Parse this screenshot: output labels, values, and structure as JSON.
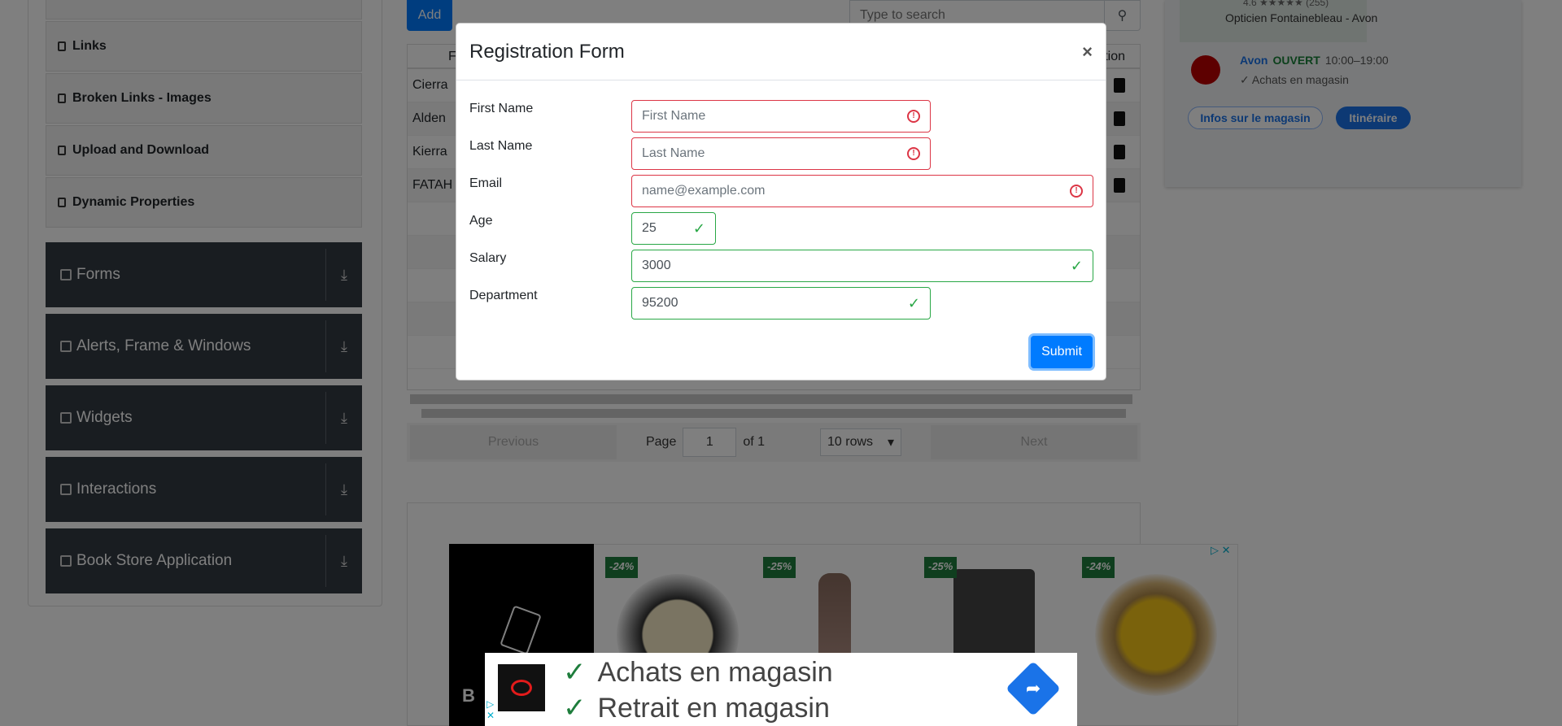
{
  "sidebar": {
    "subitems": [
      "Links",
      "Broken Links - Images",
      "Upload and Download",
      "Dynamic Properties"
    ],
    "groups": [
      "Forms",
      "Alerts, Frame & Windows",
      "Widgets",
      "Interactions",
      "Book Store Application"
    ]
  },
  "toolbar": {
    "add_label": "Add",
    "search_placeholder": "Type to search"
  },
  "table": {
    "header_first": "Fi",
    "header_action": "tion",
    "rows": [
      "Cierra",
      "Alden",
      "Kierra",
      "FATAH"
    ]
  },
  "pagination": {
    "previous": "Previous",
    "next": "Next",
    "page_label": "Page",
    "page_value": "1",
    "of_label": "of 1",
    "rows_select": "10 rows"
  },
  "map_card": {
    "rating": "4.6",
    "reviews": "(255)",
    "title": "Opticien Fontainebleau - Avon",
    "town": "Avon",
    "status": "OUVERT",
    "hours": "10:00–19:00",
    "shop": "Achats en magasin",
    "btn_info": "Infos sur le magasin",
    "btn_route": "Itinéraire"
  },
  "ad_strip": {
    "brand_letter": "B",
    "discounts": [
      "-24%",
      "-25%",
      "-25%",
      "-24%"
    ]
  },
  "modal": {
    "title": "Registration Form",
    "close": "×",
    "fields": {
      "first_name": {
        "label": "First Name",
        "placeholder": "First Name",
        "value": ""
      },
      "last_name": {
        "label": "Last Name",
        "placeholder": "Last Name",
        "value": ""
      },
      "email": {
        "label": "Email",
        "placeholder": "name@example.com",
        "value": ""
      },
      "age": {
        "label": "Age",
        "value": "25"
      },
      "salary": {
        "label": "Salary",
        "value": "3000"
      },
      "department": {
        "label": "Department",
        "value": "95200"
      }
    },
    "submit": "Submit"
  },
  "bottom_ad": {
    "line1": "Achats en magasin",
    "line2": "Retrait en magasin"
  },
  "colors": {
    "primary": "#007bff",
    "invalid": "#dc3545",
    "valid": "#28a745",
    "sidebar_group": "#333a43"
  }
}
